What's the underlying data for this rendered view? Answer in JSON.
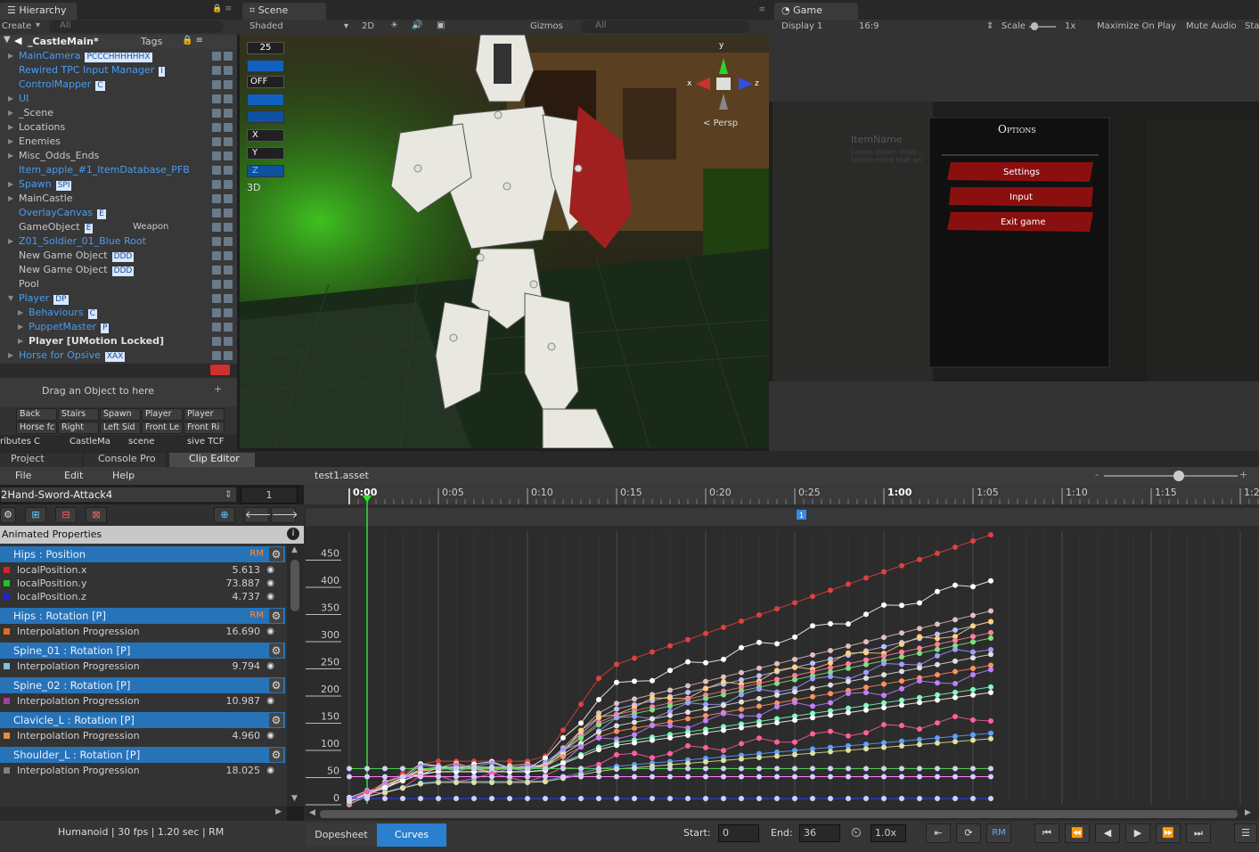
{
  "hierarchy": {
    "tab": "Hierarchy",
    "create": "Create",
    "search_placeholder": "All",
    "scene_name": "_CastleMain*",
    "tags_label": "Tags",
    "items": [
      {
        "label": "MainCamera",
        "blue": true,
        "arrow": "▶",
        "badge": "PCCCHHHHHHX"
      },
      {
        "label": "Rewired TPC Input Manager",
        "blue": true,
        "arrow": "",
        "badge": "I"
      },
      {
        "label": "ControlMapper",
        "blue": true,
        "arrow": "",
        "badge": "C"
      },
      {
        "label": "UI",
        "blue": true,
        "arrow": "▶",
        "badge": ""
      },
      {
        "label": "_Scene",
        "blue": false,
        "arrow": "▶",
        "badge": ""
      },
      {
        "label": "Locations",
        "blue": false,
        "arrow": "▶",
        "badge": ""
      },
      {
        "label": "Enemies",
        "blue": false,
        "arrow": "▶",
        "badge": ""
      },
      {
        "label": "Misc_Odds_Ends",
        "blue": false,
        "arrow": "▶",
        "badge": ""
      },
      {
        "label": "Item_apple_#1_ItemDatabase_PFB",
        "blue": true,
        "arrow": "",
        "badge": ""
      },
      {
        "label": "Spawn",
        "blue": true,
        "arrow": "▶",
        "badge": "SPI"
      },
      {
        "label": "MainCastle",
        "blue": false,
        "arrow": "▶",
        "badge": ""
      },
      {
        "label": "OverlayCanvas",
        "blue": true,
        "arrow": "",
        "badge": "E"
      },
      {
        "label": "GameObject",
        "blue": false,
        "arrow": "",
        "badge": "E",
        "extra": "Weapon"
      },
      {
        "label": "Z01_Soldier_01_Blue Root",
        "blue": true,
        "arrow": "▶",
        "badge": ""
      },
      {
        "label": "New Game Object",
        "blue": false,
        "arrow": "",
        "badge": "DDD"
      },
      {
        "label": "New Game Object",
        "blue": false,
        "arrow": "",
        "badge": "DDD"
      },
      {
        "label": "Pool",
        "blue": false,
        "arrow": "",
        "badge": ""
      },
      {
        "label": "Player",
        "blue": true,
        "arrow": "▼",
        "badge": "DP"
      },
      {
        "label": "Behaviours",
        "blue": true,
        "arrow": "▶",
        "badge": "C",
        "indent": 1
      },
      {
        "label": "PuppetMaster",
        "blue": true,
        "arrow": "▶",
        "badge": "P",
        "indent": 1
      },
      {
        "label": "Player [UMotion Locked]",
        "blue": false,
        "arrow": "▶",
        "badge": "",
        "indent": 1,
        "bold": true
      },
      {
        "label": "Horse for Opsive",
        "blue": true,
        "arrow": "▶",
        "badge": "XAX"
      }
    ],
    "drag_hint": "Drag an Object to here",
    "bookmarks_row1": [
      "Back",
      "Stairs",
      "Spawn",
      "Player",
      "Player"
    ],
    "bookmarks_row2": [
      "Horse fc",
      "Right",
      "Left Sid",
      "Front Le",
      "Front Ri"
    ],
    "scene_tabs": [
      "ributes C",
      "CastleMa",
      "scene",
      "sive TCF"
    ]
  },
  "scene": {
    "tab": "Scene",
    "shading": "Shaded",
    "mode_2d": "2D",
    "gizmos": "Gizmos",
    "search_placeholder": "All",
    "fov": "25",
    "off_label": "OFF",
    "axis_x": "X",
    "axis_y": "Y",
    "axis_z": "Z",
    "label_3d": "3D",
    "persp": "Persp",
    "gizmo_y": "y",
    "gizmo_x": "x",
    "gizmo_z": "z"
  },
  "game": {
    "tab": "Game",
    "display": "Display 1",
    "aspect": "16:9",
    "scale_label": "Scale",
    "scale_value": "1x",
    "maximize": "Maximize On Play",
    "mute": "Mute Audio",
    "stats": "Sta",
    "menu_title": "Options",
    "menu_items": [
      "Settings",
      "Input",
      "Exit game"
    ],
    "item_name": "ItemName",
    "item_desc": "Lorem ipsum dolor... Lorem more text an"
  },
  "bottom_tabs": [
    "Project",
    "Console Pro",
    "Clip Editor"
  ],
  "clip_editor": {
    "menu": [
      "File",
      "Edit",
      "Help"
    ],
    "asset": "test1.asset",
    "clip_name": "2Hand-Sword-Attack4",
    "frame": "1",
    "animated_props_label": "Animated Properties",
    "groups": [
      {
        "header": "Hips : Position",
        "rm": "RM",
        "rows": [
          {
            "name": "localPosition.x",
            "value": "5.613",
            "color": "#e02020"
          },
          {
            "name": "localPosition.y",
            "value": "73.887",
            "color": "#20c020"
          },
          {
            "name": "localPosition.z",
            "value": "4.737",
            "color": "#2020e0"
          }
        ]
      },
      {
        "header": "Hips : Rotation [P]",
        "rm": "RM",
        "rows": [
          {
            "name": "Interpolation Progression",
            "value": "16.690",
            "color": "#e07020"
          }
        ]
      },
      {
        "header": "Spine_01 : Rotation [P]",
        "rm": "",
        "rows": [
          {
            "name": "Interpolation Progression",
            "value": "9.794",
            "color": "#80c0e0"
          }
        ]
      },
      {
        "header": "Spine_02 : Rotation [P]",
        "rm": "",
        "rows": [
          {
            "name": "Interpolation Progression",
            "value": "10.987",
            "color": "#a040a0"
          }
        ]
      },
      {
        "header": "Clavicle_L : Rotation [P]",
        "rm": "",
        "rows": [
          {
            "name": "Interpolation Progression",
            "value": "4.960",
            "color": "#e09040"
          }
        ]
      },
      {
        "header": "Shoulder_L : Rotation [P]",
        "rm": "",
        "rows": [
          {
            "name": "Interpolation Progression",
            "value": "18.025",
            "color": "#808080"
          }
        ]
      }
    ],
    "status": "Humanoid | 30 fps | 1.20 sec | RM",
    "view_tabs": [
      "Dopesheet",
      "Curves"
    ],
    "start_label": "Start:",
    "start_value": "0",
    "end_label": "End:",
    "end_value": "36",
    "speed": "1.0x",
    "rm_btn": "RM",
    "event_marker": "1",
    "time_labels": [
      "0:00",
      "0:05",
      "0:10",
      "0:15",
      "0:20",
      "0:25",
      "1:00",
      "1:05",
      "1:10",
      "1:15",
      "1:2"
    ],
    "y_labels": [
      "450",
      "400",
      "350",
      "300",
      "250",
      "200",
      "150",
      "100",
      "50",
      "0"
    ]
  },
  "colors": {
    "accent_blue": "#2773b8",
    "rm_orange": "#ff8c3a",
    "curve_red": "#e04040",
    "playhead_green": "#30e030"
  }
}
